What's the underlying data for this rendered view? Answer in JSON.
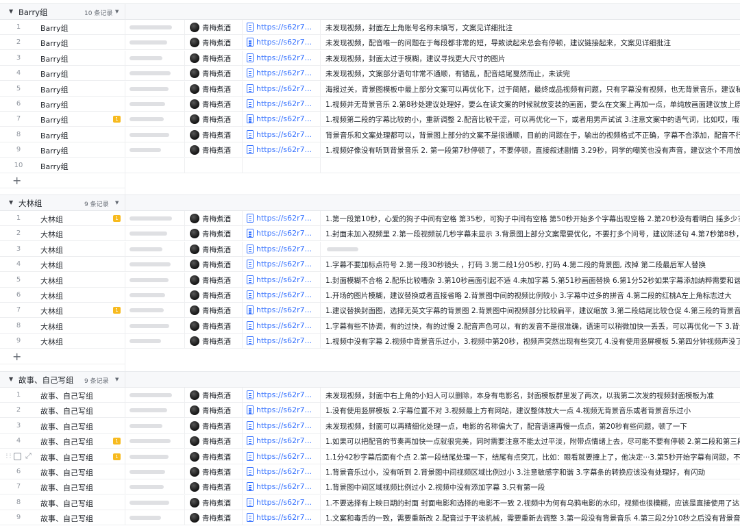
{
  "groups": [
    {
      "name": "Barry组",
      "count": "10 条记录",
      "add_label": "+",
      "rows": [
        {
          "num": "1",
          "group": "Barry组",
          "flag": "",
          "author": "青梅煮酒",
          "link": "https://s62r7...",
          "text": "未发现视频，封面左上角账号名称未填写，文案见详细批注"
        },
        {
          "num": "2",
          "group": "Barry组",
          "flag": "",
          "author": "青梅煮酒",
          "link": "https://s62r7...",
          "text": "未发现视频，配音唯一的问题在于每段都非常的短，导致读起来总会有停顿，建议链接起来，文案见详细批注"
        },
        {
          "num": "3",
          "group": "Barry组",
          "flag": "",
          "author": "青梅煮酒",
          "link": "https://s62r7...",
          "text": "未发现视频，封面太过于模糊，建议寻找更大尺寸的图片"
        },
        {
          "num": "4",
          "group": "Barry组",
          "flag": "",
          "author": "青梅煮酒",
          "link": "https://s62r7...",
          "text": "未发现视频，文案部分语句非常不通顺，有错乱，配音结尾戛然而止，未读完"
        },
        {
          "num": "5",
          "group": "Barry组",
          "flag": "",
          "author": "青梅煮酒",
          "link": "https://s62r7...",
          "text": "海报过关，背景图模板中最上部分文案可以再优化下，过于简陋，最终成品视频有问题，只有字幕没有视频，也无背景音乐，建议私聊解决处"
        },
        {
          "num": "6",
          "group": "Barry组",
          "flag": "",
          "author": "青梅煮酒",
          "link": "https://s62r7...",
          "text": "1.视频并无背景音乐 2.第8秒处建议处理好，要么在读文案的时候就放变装的画面，要么在文案上再加一点，单纯放画面建议放上原声过渡 3."
        },
        {
          "num": "7",
          "group": "Barry组",
          "flag": "1",
          "author": "青梅煮酒",
          "link": "https://s62r7...",
          "text": "1.视频第二段的字幕比较的小，重新调整 2.配音比较干涩，可以再优化一下，或者用男声试试 3.注意文案中的语气词，比如哎，哦，AI配音读"
        },
        {
          "num": "8",
          "group": "Barry组",
          "flag": "",
          "author": "青梅煮酒",
          "link": "https://s62r7...",
          "text": "背景音乐和文案处理都可以，背景图上部分的文案不是很通顺，目前的问题在于，输出的视频格式不正确，字幕不合添加，配音不行，语速过"
        },
        {
          "num": "9",
          "group": "Barry组",
          "flag": "",
          "author": "青梅煮酒",
          "link": "https://s62r7...",
          "text": "1.视频好像没有听到背景音乐 2. 第一段第7秒停顿了，不要停顿，直接叙述剧情 3.29秒，同学的嘲笑也没有声音，建议这个不用放画声，直接"
        },
        {
          "num": "10",
          "group": "Barry组",
          "flag": "",
          "author": "",
          "link": "",
          "text": ""
        }
      ]
    },
    {
      "name": "大林组",
      "count": "9 条记录",
      "add_label": "+",
      "rows": [
        {
          "num": "1",
          "group": "大林组",
          "flag": "1",
          "author": "青梅煮酒",
          "link": "https://s62r7...",
          "text": "1.第一段第10秒，心爱的狗子中间有空格 第35秒，可狗子中间有空格 第50秒开始多个字幕出现空格 2.第20秒没有看明白 摇多少？ 3.用枪爆"
        },
        {
          "num": "2",
          "group": "大林组",
          "flag": "",
          "author": "青梅煮酒",
          "link": "https://s62r7...",
          "text": "1.封面未加入视频里 2.第一段视频前几秒字幕未显示 3.背景图上部分文案需要优化，不要打多个问号，建议陈述句 4.第7秒第8秒，突然，过度"
        },
        {
          "num": "3",
          "group": "大林组",
          "flag": "",
          "author": "青梅煮酒",
          "link": "https://s62r7...",
          "text": ""
        },
        {
          "num": "4",
          "group": "大林组",
          "flag": "",
          "author": "青梅煮酒",
          "link": "https://s62r7...",
          "text": "1.字幕不要加标点符号 2.第一段30秒镜头      ，打码 3.第二段1分05秒,            打码 4.第二段的背景图,             改掉 第二段最后军人替换"
        },
        {
          "num": "5",
          "group": "大林组",
          "flag": "",
          "author": "青梅煮酒",
          "link": "https://s62r7...",
          "text": "1.封面模糊不合格 2.配乐比较嘈杂 3.第10秒画面引起不适 4.未加字幕 5.第51秒画面替换 6.第1分52秒如果字幕添加纳粹需要和谐掉 7.第一段结"
        },
        {
          "num": "6",
          "group": "大林组",
          "flag": "",
          "author": "青梅煮酒",
          "link": "https://s62r7...",
          "text": "1.开场的图片模糊，建议替换或者直接省略 2.背景图中间的视频比例较小 3.字幕中过多的拼音 4.第二段的红桃A左上角标志过大"
        },
        {
          "num": "7",
          "group": "大林组",
          "flag": "1",
          "author": "青梅煮酒",
          "link": "https://s62r7...",
          "text": "1.建议替换封面图，选择无英文字幕的背景图 2.背景图中间视频部分比较扁平，建议缩放 3.第二段结尾比较仓促 4.第三段的背景音乐不是很好"
        },
        {
          "num": "8",
          "group": "大林组",
          "flag": "",
          "author": "青梅煮酒",
          "link": "https://s62r7...",
          "text": "1.字幕有些不协调，有的过快，有的过慢 2.配音声色可以，有的发音不是很准确，语速可以稍微加快一丢丢，可以再优化一下 3.背景音乐建议"
        },
        {
          "num": "9",
          "group": "大林组",
          "flag": "",
          "author": "青梅煮酒",
          "link": "https://s62r7...",
          "text": "1.视频中没有字幕 2.视频中背景音乐过小，3.视频中第20秒，视频声突然出现有些突兀 4.没有使用竖屏模板 5.第四分钟视频声没了之后，整体"
        }
      ]
    },
    {
      "name": "故事、自己写组",
      "count": "9 条记录",
      "add_label": "+",
      "rows": [
        {
          "num": "1",
          "group": "故事、自己写组",
          "flag": "",
          "author": "青梅煮酒",
          "link": "https://s62r7...",
          "text": "未发现视频，封面中右上角的小妇人可以删除，本身有电影名，封面模板群里发了两次，以我第二次发的视频封面模板为准"
        },
        {
          "num": "2",
          "group": "故事、自己写组",
          "flag": "",
          "author": "青梅煮酒",
          "link": "https://s62r7...",
          "text": "1.没有使用竖屏模板 2.字幕位置不对 3.视频最上方有网站，建议整体放大一点 4.视频无背景音乐或者背景音乐过小"
        },
        {
          "num": "3",
          "group": "故事、自己写组",
          "flag": "",
          "author": "青梅煮酒",
          "link": "https://s62r7...",
          "text": "未发现视频，封面可以再精细化处理一点，电影的名称偏大了，配音语速再慢一点点，第20秒有些问题，顿了一下"
        },
        {
          "num": "4",
          "group": "故事、自己写组",
          "flag": "1",
          "author": "青梅煮酒",
          "link": "https://s62r7...",
          "text": "1.如果可以把配音的节奏再加快一点就很完美，同时需要注意不能太过平淡，附带点情绪上去，尽可能不要有停顿 2.第二段和第三段的开头和"
        },
        {
          "num": "5",
          "group": "故事、自己写组",
          "flag": "1",
          "author": "青梅煮酒",
          "link": "https://s62r7...",
          "text": "1.1分42秒字幕后面有个点 2.第一段结尾处理一下，结尾有点突兀，比如：眼看就要撞上了，他决定···3.第5秒开始字幕有问题，不匹配",
          "hover": true
        },
        {
          "num": "6",
          "group": "故事、自己写组",
          "flag": "",
          "author": "青梅煮酒",
          "link": "https://s62r7...",
          "text": "1.背景音乐过小，没有听到 2.背景图中间视频区域比例过小 3.注意敏感字和谐 3.字幕条的转换应该没有处理好，有闪动"
        },
        {
          "num": "7",
          "group": "故事、自己写组",
          "flag": "",
          "author": "青梅煮酒",
          "link": "https://s62r7...",
          "text": "1.背景图中间区域视频比例过小 2.视频中没有添加字幕 3.只有第一段"
        },
        {
          "num": "8",
          "group": "故事、自己写组",
          "flag": "",
          "author": "青梅煮酒",
          "link": "https://s62r7...",
          "text": "1.不要选择有上映日期的封面 封面电影和选择的电影不一致 2.视频中为何有乌鸦电影的水印，视频也很模糊，应该是直接使用了达人剪辑的片"
        },
        {
          "num": "9",
          "group": "故事、自己写组",
          "flag": "",
          "author": "青梅煮酒",
          "link": "https://s62r7...",
          "text": "1.文案和毒舌的一致，需要重新改 2.配音过于平淡机械，需要重新去调整 3.第一段没有背景音乐 4.第三段2分10秒之后没有背景音乐"
        }
      ]
    }
  ],
  "icons": {
    "caret": "caret-down-icon",
    "drop": "dropdown-icon",
    "doc": "document-icon",
    "drag": "drag-handle-icon",
    "expand": "expand-icon",
    "checkbox": "checkbox-icon"
  },
  "colors": {
    "link": "#3370ff",
    "flag": "#f7ba1e",
    "header_bg": "#f7f8fa"
  }
}
